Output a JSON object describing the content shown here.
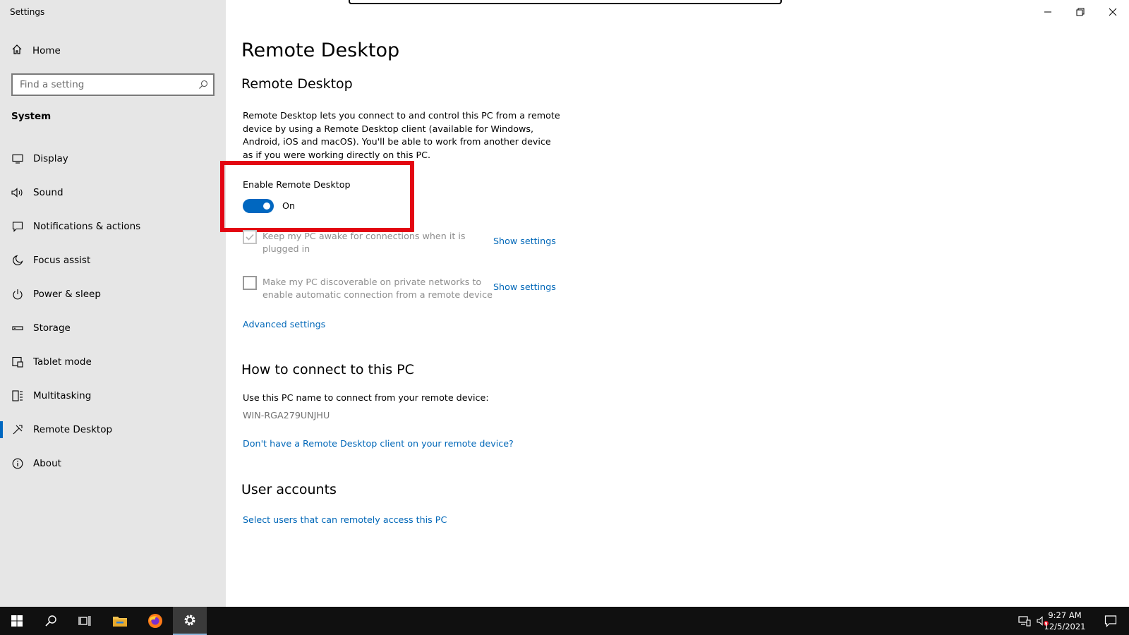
{
  "window": {
    "app_title": "Settings"
  },
  "sidebar": {
    "home_label": "Home",
    "search_placeholder": "Find a setting",
    "section_title": "System",
    "items": [
      {
        "label": "Display",
        "icon": "monitor-icon"
      },
      {
        "label": "Sound",
        "icon": "speaker-icon"
      },
      {
        "label": "Notifications & actions",
        "icon": "notification-icon"
      },
      {
        "label": "Focus assist",
        "icon": "moon-icon"
      },
      {
        "label": "Power & sleep",
        "icon": "power-icon"
      },
      {
        "label": "Storage",
        "icon": "storage-icon"
      },
      {
        "label": "Tablet mode",
        "icon": "tablet-icon"
      },
      {
        "label": "Multitasking",
        "icon": "multitasking-icon"
      },
      {
        "label": "Remote Desktop",
        "icon": "remote-desktop-icon",
        "active": true
      },
      {
        "label": "About",
        "icon": "info-icon"
      }
    ]
  },
  "main": {
    "page_title": "Remote Desktop",
    "section_title": "Remote Desktop",
    "description": "Remote Desktop lets you connect to and control this PC from a remote device by using a Remote Desktop client (available for Windows, Android, iOS and macOS). You'll be able to work from another device as if you were working directly on this PC.",
    "enable_label": "Enable Remote Desktop",
    "toggle_state": "On",
    "toggle_on": true,
    "options": [
      {
        "text": "Keep my PC awake for connections when it is plugged in",
        "checked": true,
        "disabled": true,
        "link": "Show settings"
      },
      {
        "text": "Make my PC discoverable on private networks to enable automatic connection from a remote device",
        "checked": false,
        "disabled": false,
        "link": "Show settings"
      }
    ],
    "advanced_link": "Advanced settings",
    "connect_title": "How to connect to this PC",
    "connect_text": "Use this PC name to connect from your remote device:",
    "pc_name": "WIN-RGA279UNJHU",
    "client_link": "Don't have a Remote Desktop client on your remote device?",
    "accounts_title": "User accounts",
    "accounts_link": "Select users that can remotely access this PC"
  },
  "taskbar": {
    "apps": [
      "start-icon",
      "search-icon",
      "task-view-icon",
      "file-explorer-icon",
      "firefox-icon",
      "settings-gear-icon"
    ],
    "time": "9:27 AM",
    "date": "12/5/2021"
  },
  "colors": {
    "accent": "#0067c0",
    "link": "#0067b8",
    "highlight": "#e30613",
    "sidebar_bg": "#e6e6e6",
    "taskbar_bg": "#101010"
  }
}
